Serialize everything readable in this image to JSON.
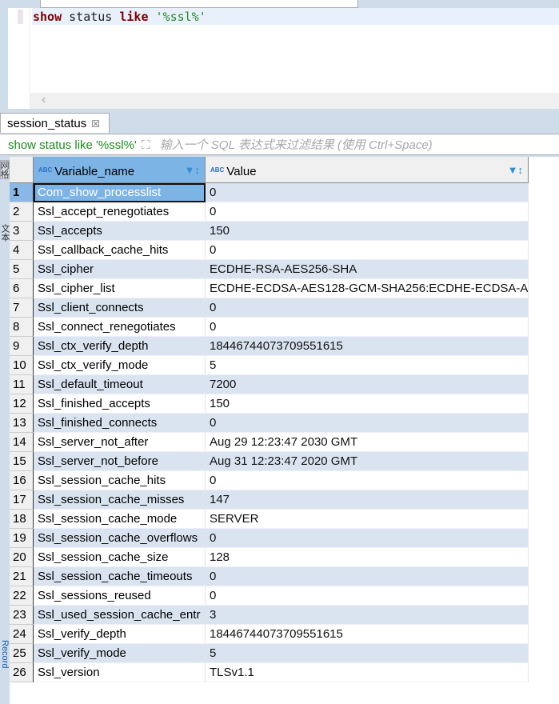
{
  "editor": {
    "kw1": "show",
    "mid": " status ",
    "kw2": "like",
    "str": " '%ssl%'"
  },
  "result_tab": {
    "label": "session_status",
    "close": "☒"
  },
  "filter": {
    "query": "show status like '%ssl%'",
    "placeholder": "输入一个 SQL 表达式来过滤结果 (使用 Ctrl+Space)"
  },
  "columns": [
    {
      "label": "Variable_name",
      "type_icon": "ABC"
    },
    {
      "label": "Value",
      "type_icon": "ABC"
    }
  ],
  "side_tabs": [
    "网格",
    "文本",
    "Record"
  ],
  "rows": [
    [
      "1",
      "Com_show_processlist",
      "0"
    ],
    [
      "2",
      "Ssl_accept_renegotiates",
      "0"
    ],
    [
      "3",
      "Ssl_accepts",
      "150"
    ],
    [
      "4",
      "Ssl_callback_cache_hits",
      "0"
    ],
    [
      "5",
      "Ssl_cipher",
      "ECDHE-RSA-AES256-SHA"
    ],
    [
      "6",
      "Ssl_cipher_list",
      "ECDHE-ECDSA-AES128-GCM-SHA256:ECDHE-ECDSA-A"
    ],
    [
      "7",
      "Ssl_client_connects",
      "0"
    ],
    [
      "8",
      "Ssl_connect_renegotiates",
      "0"
    ],
    [
      "9",
      "Ssl_ctx_verify_depth",
      "18446744073709551615"
    ],
    [
      "10",
      "Ssl_ctx_verify_mode",
      "5"
    ],
    [
      "11",
      "Ssl_default_timeout",
      "7200"
    ],
    [
      "12",
      "Ssl_finished_accepts",
      "150"
    ],
    [
      "13",
      "Ssl_finished_connects",
      "0"
    ],
    [
      "14",
      "Ssl_server_not_after",
      "Aug 29 12:23:47 2030 GMT"
    ],
    [
      "15",
      "Ssl_server_not_before",
      "Aug 31 12:23:47 2020 GMT"
    ],
    [
      "16",
      "Ssl_session_cache_hits",
      "0"
    ],
    [
      "17",
      "Ssl_session_cache_misses",
      "147"
    ],
    [
      "18",
      "Ssl_session_cache_mode",
      "SERVER"
    ],
    [
      "19",
      "Ssl_session_cache_overflows",
      "0"
    ],
    [
      "20",
      "Ssl_session_cache_size",
      "128"
    ],
    [
      "21",
      "Ssl_session_cache_timeouts",
      "0"
    ],
    [
      "22",
      "Ssl_sessions_reused",
      "0"
    ],
    [
      "23",
      "Ssl_used_session_cache_entr",
      "3"
    ],
    [
      "24",
      "Ssl_verify_depth",
      "18446744073709551615"
    ],
    [
      "25",
      "Ssl_verify_mode",
      "5"
    ],
    [
      "26",
      "Ssl_version",
      "TLSv1.1"
    ]
  ]
}
